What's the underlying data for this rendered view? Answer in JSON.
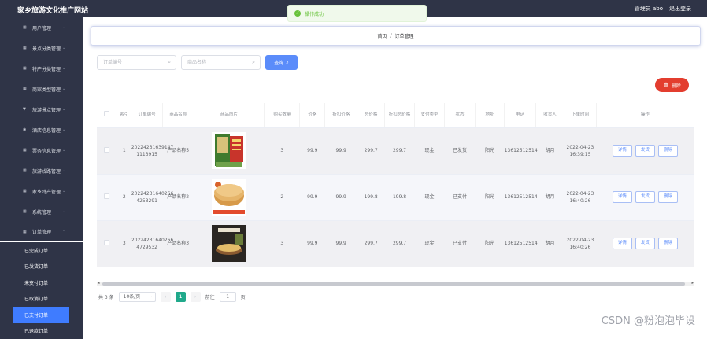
{
  "app": {
    "title": "家乡旅游文化推广网站"
  },
  "header": {
    "admin_label": "管理员 abo",
    "logout_label": "退出登录"
  },
  "toast": {
    "message": "操作成功",
    "icon": "check-circle-icon"
  },
  "sidebar": {
    "items": [
      {
        "label": "用户管理",
        "icon": "grid-icon"
      },
      {
        "label": "景点分类管理",
        "icon": "grid-icon"
      },
      {
        "label": "特产分类管理",
        "icon": "grid-icon"
      },
      {
        "label": "商家类型管理",
        "icon": "grid-icon"
      },
      {
        "label": "旅游景点管理",
        "icon": "filter-icon"
      },
      {
        "label": "酒店信息管理",
        "icon": "pin-icon"
      },
      {
        "label": "票务信息管理",
        "icon": "grid-icon"
      },
      {
        "label": "旅游线路管理",
        "icon": "grid-icon"
      },
      {
        "label": "家乡特产管理",
        "icon": "grid-icon"
      },
      {
        "label": "系统管理",
        "icon": "grid-icon"
      },
      {
        "label": "订单管理",
        "icon": "grid-icon"
      }
    ],
    "sub_items": [
      {
        "label": "已完成订单"
      },
      {
        "label": "已发货订单"
      },
      {
        "label": "未支付订单"
      },
      {
        "label": "已取消订单"
      },
      {
        "label": "已支付订单"
      },
      {
        "label": "已退款订单"
      }
    ]
  },
  "breadcrumb": {
    "home": "首页",
    "sep": "/",
    "current": "订单管理"
  },
  "search": {
    "order_placeholder": "订单编号",
    "product_placeholder": "商品名称",
    "query_label": "查询"
  },
  "actions": {
    "delete_label": "删除"
  },
  "table": {
    "headers": [
      "索引",
      "订单编号",
      "商品名称",
      "商品图片",
      "购买数量",
      "价格",
      "折扣价格",
      "总价格",
      "折扣总价格",
      "支付类型",
      "状态",
      "地址",
      "电话",
      "收货人",
      "下单时间",
      "操作"
    ],
    "rows": [
      {
        "index": "1",
        "order_no": "20224231639147 1113915",
        "product": "产品名称5",
        "qty": "3",
        "price": "99.9",
        "discount_price": "99.9",
        "total": "299.7",
        "discount_total": "299.7",
        "pay_type": "现金",
        "status": "已发货",
        "address": "阳光",
        "phone": "13612512514",
        "receiver": "胡月",
        "time": "2022-04-23 16:39:15"
      },
      {
        "index": "2",
        "order_no": "20224231640266 4253291",
        "product": "产品名称2",
        "qty": "2",
        "price": "99.9",
        "discount_price": "99.9",
        "total": "199.8",
        "discount_total": "199.8",
        "pay_type": "现金",
        "status": "已支付",
        "address": "阳光",
        "phone": "13612512514",
        "receiver": "胡月",
        "time": "2022-04-23 16:40:26"
      },
      {
        "index": "3",
        "order_no": "20224231640266 4729532",
        "product": "产品名称3",
        "qty": "3",
        "price": "99.9",
        "discount_price": "99.9",
        "total": "299.7",
        "discount_total": "299.7",
        "pay_type": "现金",
        "status": "已支付",
        "address": "阳光",
        "phone": "13612512514",
        "receiver": "胡月",
        "time": "2022-04-23 16:40:26"
      }
    ],
    "row_buttons": {
      "detail": "详情",
      "ship": "发货",
      "delete": "删除"
    }
  },
  "pagination": {
    "total": "共 3 条",
    "page_size": "10条/页",
    "current": "1",
    "goto_label": "前往",
    "goto_value": "1",
    "page_suffix": "页",
    "prev": "‹",
    "next": "›"
  },
  "watermark": "CSDN @粉泡泡毕设"
}
